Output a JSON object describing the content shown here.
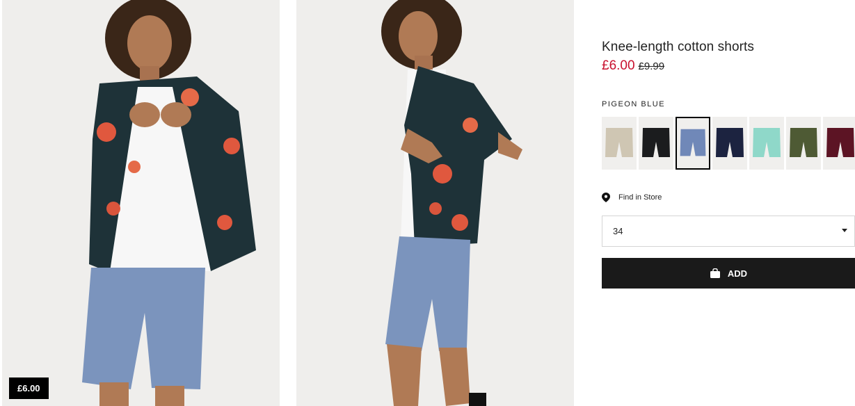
{
  "product": {
    "title": "Knee-length cotton shorts",
    "price_sale": "£6.00",
    "price_old": "£9.99",
    "photo_price_tag": "£6.00"
  },
  "colors": {
    "selected_label": "PIGEON BLUE",
    "swatches": [
      {
        "name": "beige",
        "hex": "#cfc6b3",
        "selected": false
      },
      {
        "name": "black",
        "hex": "#1b1c1e",
        "selected": false
      },
      {
        "name": "pigeon blue",
        "hex": "#7088b8",
        "selected": true
      },
      {
        "name": "dark blue",
        "hex": "#1c2340",
        "selected": false
      },
      {
        "name": "mint green",
        "hex": "#8fd8c9",
        "selected": false
      },
      {
        "name": "khaki green",
        "hex": "#4e5a34",
        "selected": false
      },
      {
        "name": "burgundy",
        "hex": "#5c1424",
        "selected": false
      }
    ]
  },
  "store": {
    "label": "Find in Store"
  },
  "size": {
    "selected": "34"
  },
  "cart": {
    "add_label": "ADD"
  },
  "theme": {
    "sale_color": "#c8102e",
    "button_color": "#1a1a1a"
  }
}
